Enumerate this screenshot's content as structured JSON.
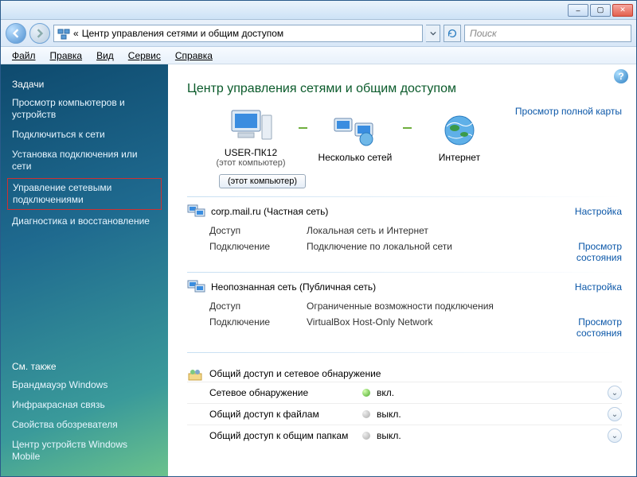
{
  "titlebar": {
    "min": "–",
    "max": "▢",
    "close": "✕"
  },
  "nav": {
    "breadcrumb_icon": "«",
    "breadcrumb": "Центр управления сетями и общим доступом",
    "search_placeholder": "Поиск"
  },
  "menu": {
    "file": "Файл",
    "edit": "Правка",
    "view": "Вид",
    "tools": "Сервис",
    "help": "Справка"
  },
  "sidebar": {
    "tasks_title": "Задачи",
    "items": [
      "Просмотр компьютеров и устройств",
      "Подключиться к сети",
      "Установка подключения или сети",
      "Управление сетевыми подключениями",
      "Диагностика и восстановление"
    ],
    "see_also_title": "См. также",
    "see_also": [
      "Брандмауэр Windows",
      "Инфракрасная связь",
      "Свойства обозревателя",
      "Центр устройств Windows Mobile"
    ]
  },
  "main": {
    "title": "Центр управления сетями и общим доступом",
    "full_map": "Просмотр полной карты",
    "node_pc": "USER-ПК12",
    "node_pc_sub": "(этот компьютер)",
    "node_multi": "Несколько сетей",
    "node_internet": "Интернет",
    "this_computer_btn": "(этот компьютер)",
    "settings_link": "Настройка",
    "view_status": "Просмотр состояния",
    "net1": {
      "name": "corp.mail.ru (Частная сеть)",
      "access_k": "Доступ",
      "access_v": "Локальная сеть и Интернет",
      "conn_k": "Подключение",
      "conn_v": "Подключение по локальной сети"
    },
    "net2": {
      "name": "Неопознанная сеть (Публичная сеть)",
      "access_k": "Доступ",
      "access_v": "Ограниченные возможности подключения",
      "conn_k": "Подключение",
      "conn_v": "VirtualBox Host-Only Network"
    },
    "sharing_title": "Общий доступ и сетевое обнаружение",
    "opts": [
      {
        "k": "Сетевое обнаружение",
        "v": "вкл.",
        "on": true
      },
      {
        "k": "Общий доступ к файлам",
        "v": "выкл.",
        "on": false
      },
      {
        "k": "Общий доступ к общим папкам",
        "v": "выкл.",
        "on": false
      }
    ]
  }
}
